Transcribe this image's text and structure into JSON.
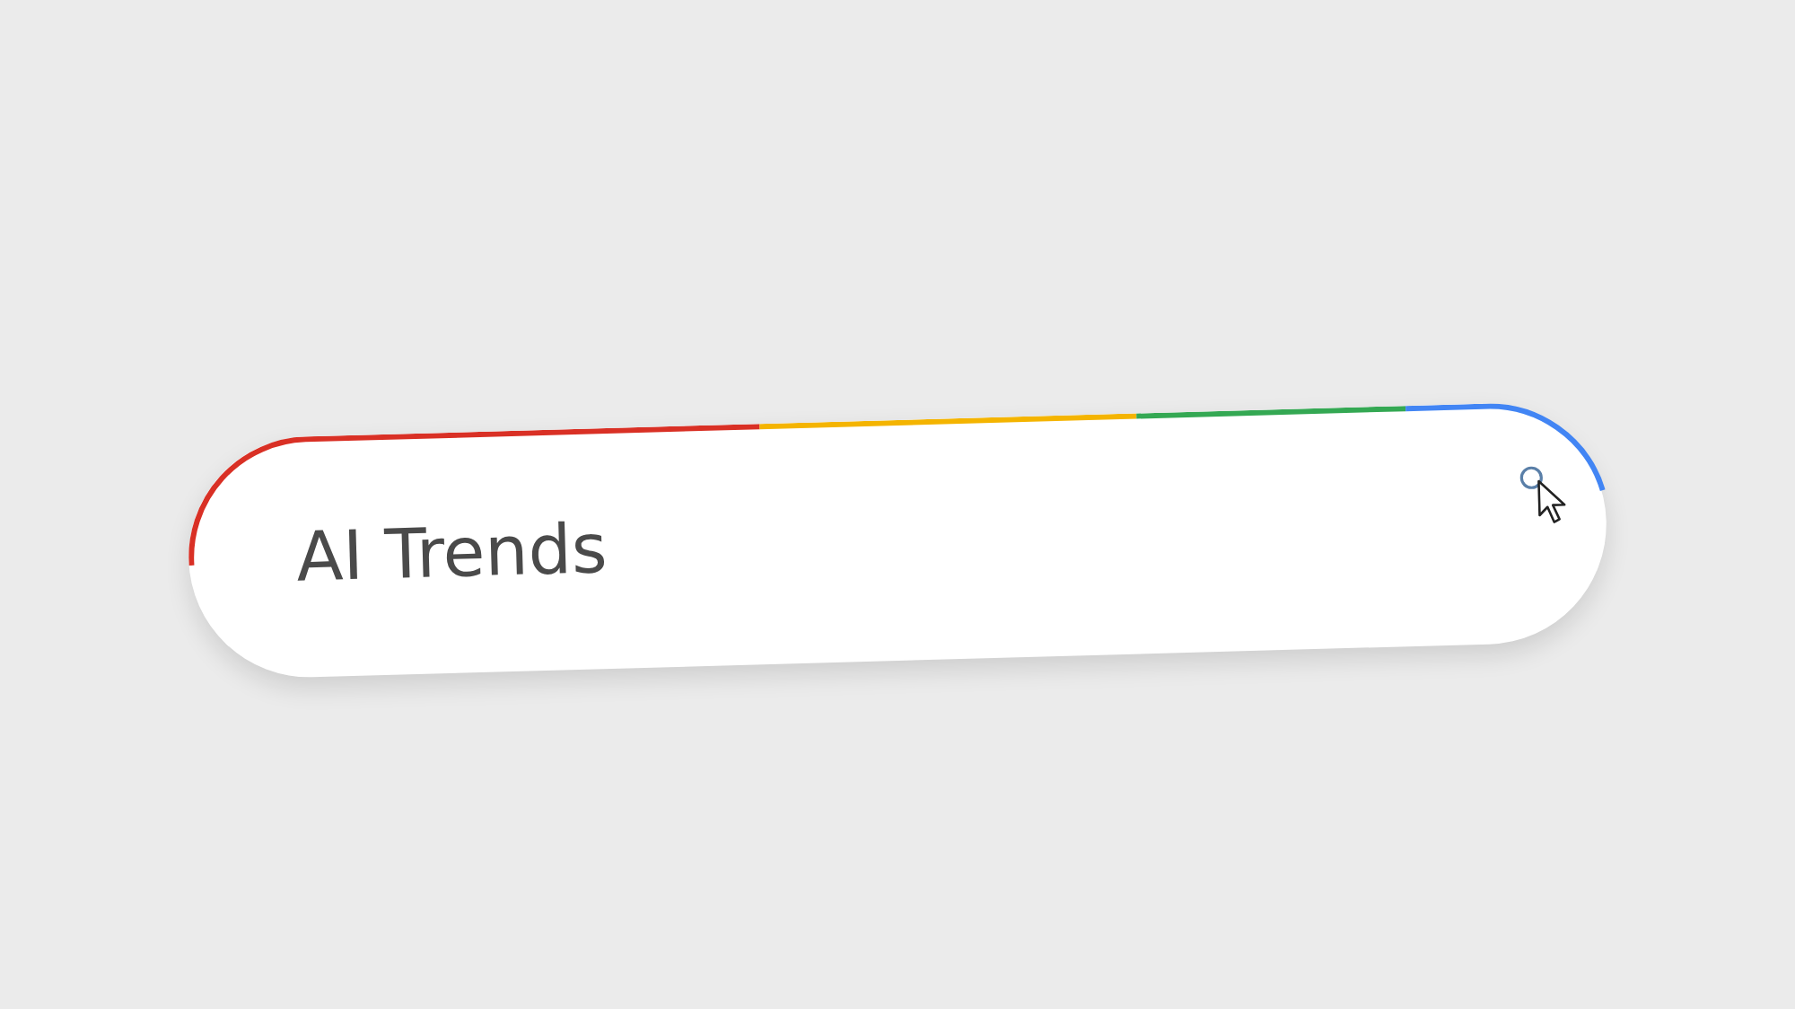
{
  "search": {
    "value": "AI Trends"
  }
}
